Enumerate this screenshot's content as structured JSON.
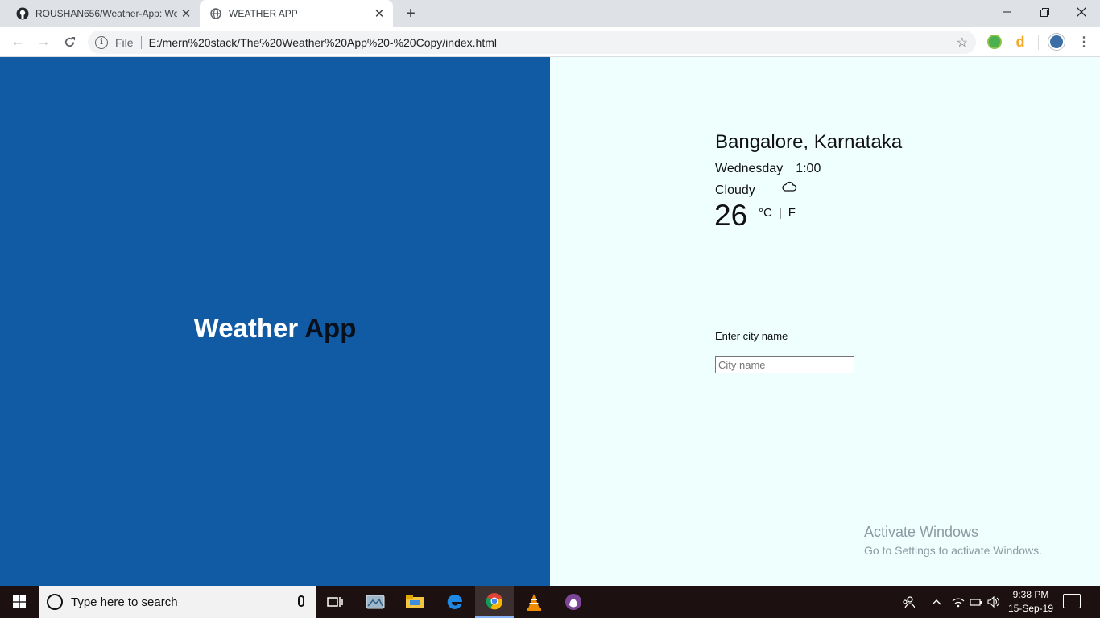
{
  "browser": {
    "tabs": [
      {
        "title": "ROUSHAN656/Weather-App: We",
        "icon": "github-icon"
      },
      {
        "title": "WEATHER APP",
        "icon": "globe-icon"
      }
    ],
    "new_tab": "+",
    "omnibox": {
      "scheme_label": "File",
      "url": "E:/mern%20stack/The%20Weather%20App%20-%20Copy/index.html"
    }
  },
  "app": {
    "brand": {
      "word1": "Weather",
      "word2": "App"
    },
    "weather": {
      "location": "Bangalore, Karnataka",
      "day": "Wednesday",
      "time": "1:00",
      "condition": "Cloudy",
      "condition_icon": "cloud-icon",
      "temperature": "26",
      "unit_c": "°C",
      "unit_sep": "|",
      "unit_f": "F"
    },
    "search": {
      "label": "Enter city name",
      "placeholder": "City name",
      "value": ""
    },
    "colors": {
      "left_bg": "#105ba3",
      "right_bg": "#effffe"
    }
  },
  "watermark": {
    "line1": "Activate Windows",
    "line2": "Go to Settings to activate Windows."
  },
  "taskbar": {
    "search_placeholder": "Type here to search",
    "pinned": [
      "task-view-icon",
      "photos-icon",
      "file-explorer-icon",
      "edge-icon",
      "chrome-icon",
      "vlc-icon",
      "tor-icon"
    ],
    "clock_time": "9:38 PM",
    "clock_date": "15-Sep-19"
  }
}
